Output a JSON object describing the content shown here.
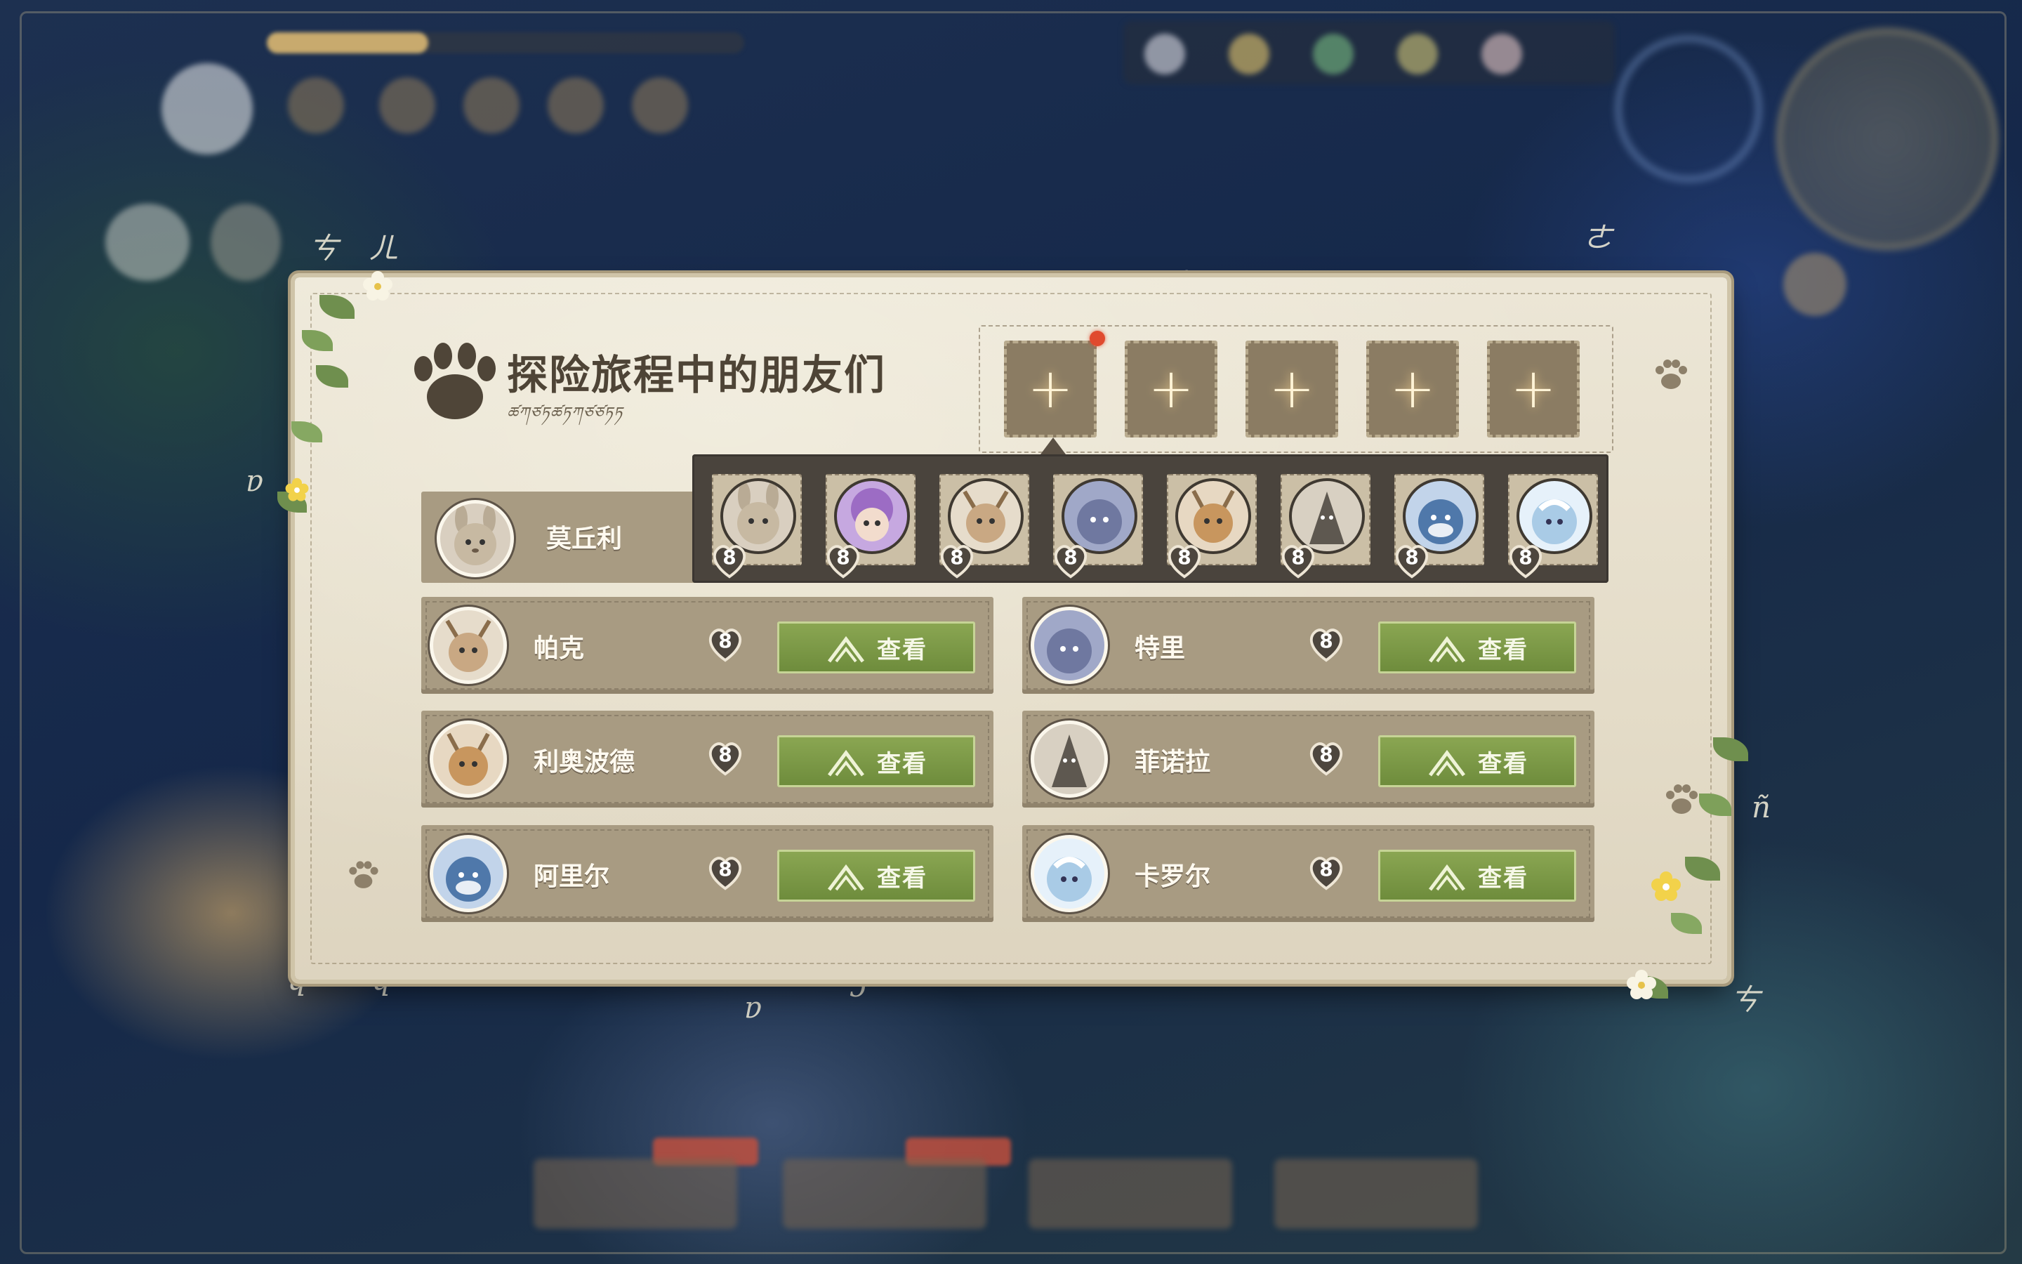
{
  "panel": {
    "title": "探险旅程中的朋友们",
    "subtitle": "ཚཀཙཏཚཏཀཙཙཏཏ",
    "slots": [
      {
        "symbol": "+",
        "has_alert": true
      },
      {
        "symbol": "+",
        "has_alert": false
      },
      {
        "symbol": "+",
        "has_alert": false
      },
      {
        "symbol": "+",
        "has_alert": false
      },
      {
        "symbol": "+",
        "has_alert": false
      }
    ],
    "selected_friend": {
      "name": "莫丘利"
    },
    "strip": [
      {
        "level": "8",
        "color": "#d9cfc0"
      },
      {
        "level": "8",
        "color": "#b58ad0"
      },
      {
        "level": "8",
        "color": "#d5c4a8"
      },
      {
        "level": "8",
        "color": "#7c86ad"
      },
      {
        "level": "8",
        "color": "#d4b48c"
      },
      {
        "level": "8",
        "color": "#5e5850"
      },
      {
        "level": "8",
        "color": "#5d86b8"
      },
      {
        "level": "8",
        "color": "#bcd9ef"
      }
    ],
    "friends": [
      {
        "name": "帕克",
        "level": "8",
        "button": "查看",
        "color": "#d8c09a"
      },
      {
        "name": "特里",
        "level": "8",
        "button": "查看",
        "color": "#7c86ad"
      },
      {
        "name": "利奥波德",
        "level": "8",
        "button": "查看",
        "color": "#d4b48c"
      },
      {
        "name": "菲诺拉",
        "level": "8",
        "button": "查看",
        "color": "#5e5850"
      },
      {
        "name": "阿里尔",
        "level": "8",
        "button": "查看",
        "color": "#5d86b8"
      },
      {
        "name": "卡罗尔",
        "level": "8",
        "button": "查看",
        "color": "#bcd9ef"
      }
    ]
  },
  "theme": {
    "button_green": "#7a9847",
    "panel_bg": "#e8e1cf",
    "row_bg": "#a89b82",
    "alert_red": "#e04a2e"
  }
}
